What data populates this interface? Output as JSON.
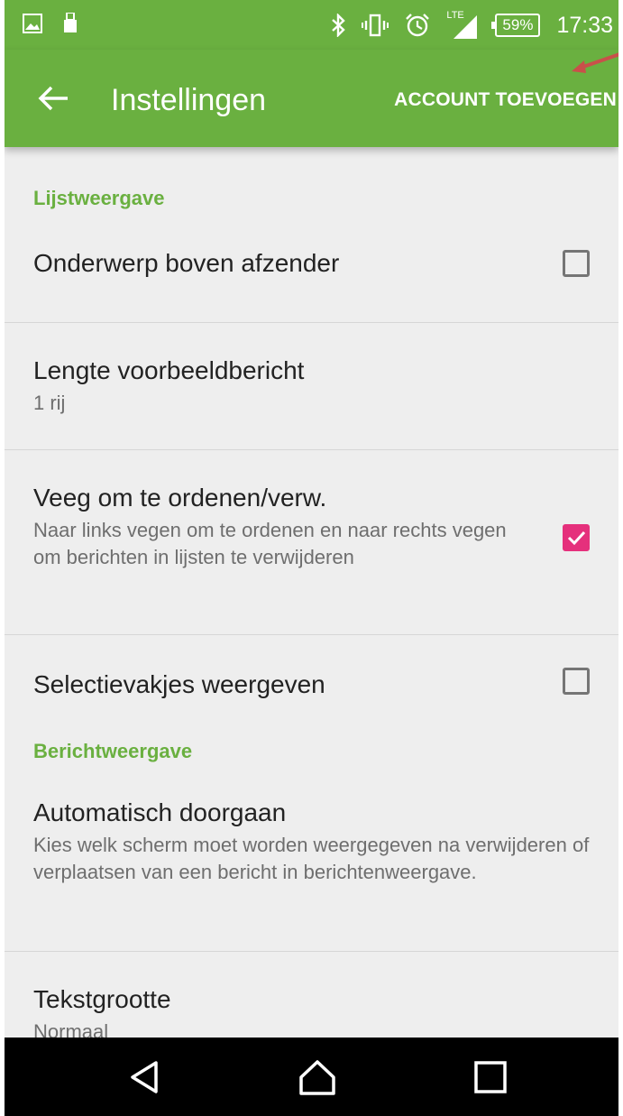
{
  "status_bar": {
    "battery": "59%",
    "time": "17:33",
    "network": "LTE",
    "icons": [
      "image-icon",
      "usb-icon",
      "bluetooth-icon",
      "vibrate-icon",
      "alarm-icon",
      "signal-icon"
    ]
  },
  "app_bar": {
    "title": "Instellingen",
    "action": "ACCOUNT TOEVOEGEN",
    "color": "#6ab040"
  },
  "sections": [
    {
      "header": "Lijstweergave",
      "items": [
        {
          "title": "Onderwerp boven afzender",
          "checkbox": false
        },
        {
          "title": "Lengte voorbeeldbericht",
          "subtitle": "1 rij"
        },
        {
          "title": "Veeg om te ordenen/verw.",
          "subtitle": "Naar links vegen om te ordenen en naar rechts vegen om berichten in lijsten te verwijderen",
          "checkbox": true
        },
        {
          "title": "Selectievakjes weergeven",
          "checkbox": false
        }
      ]
    },
    {
      "header": "Berichtweergave",
      "items": [
        {
          "title": "Automatisch doorgaan",
          "subtitle": "Kies welk scherm moet worden weergegeven na verwijderen of verplaatsen van een bericht in berichtenweergave."
        },
        {
          "title": "Tekstgrootte",
          "subtitle": "Normaal"
        }
      ]
    }
  ],
  "colors": {
    "accent": "#6ab040",
    "checkbox_checked": "#e5307c",
    "annotation_arrow": "#c9504a"
  },
  "nav_bar": {
    "buttons": [
      "back-icon",
      "home-icon",
      "recents-icon"
    ]
  }
}
